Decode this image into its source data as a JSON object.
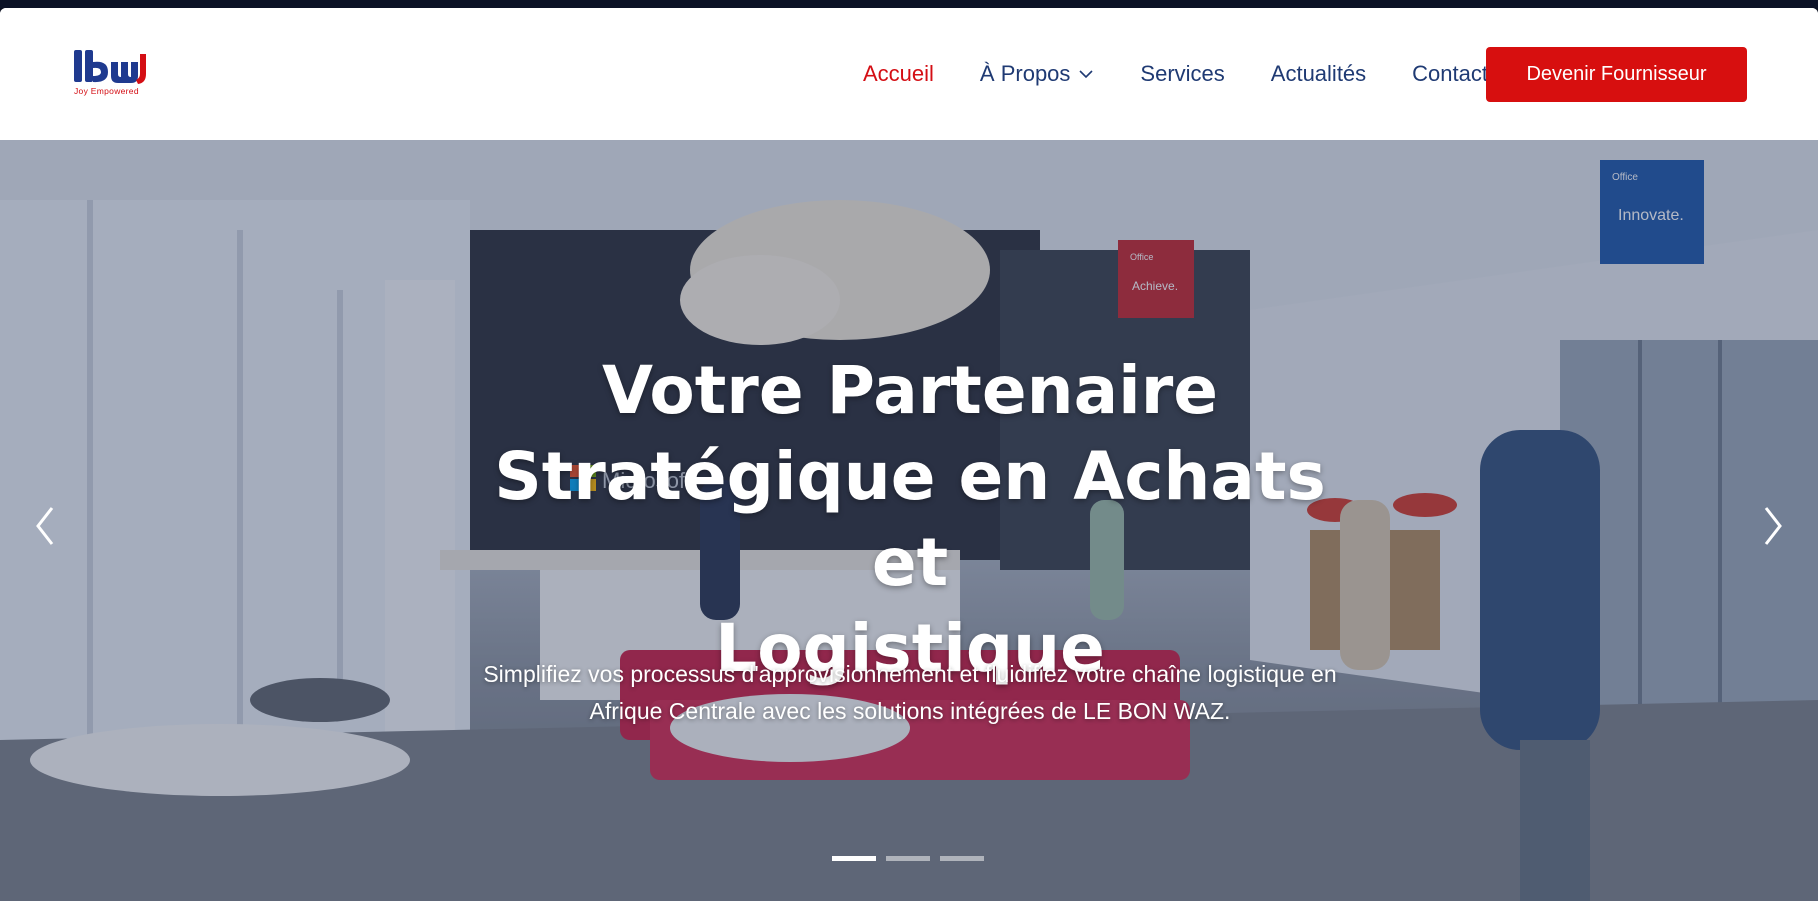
{
  "brand": {
    "logo_text": "lbw",
    "tagline": "Joy Empowered",
    "colors": {
      "blue": "#1f3a8f",
      "red": "#d40e14"
    }
  },
  "nav": {
    "items": [
      {
        "label": "Accueil",
        "active": true
      },
      {
        "label": "À Propos",
        "has_dropdown": true
      },
      {
        "label": "Services"
      },
      {
        "label": "Actualités"
      },
      {
        "label": "Contact"
      }
    ],
    "cta_label": "Devenir Fournisseur"
  },
  "hero": {
    "title_line1": "Votre Partenaire",
    "title_line2": "Stratégique en Achats et",
    "title_line3": "Logistique",
    "subtitle_line1": "Simplifiez vos processus d'approvisionnement et fluidifiez votre chaîne logistique en",
    "subtitle_line2": "Afrique Centrale avec les solutions intégrées de LE BON WAZ.",
    "background_signs": {
      "microsoft": "Microsoft",
      "office_red": "Office",
      "office_red_word": "Achieve.",
      "office_blue": "Office",
      "office_blue_word": "Innovate."
    },
    "slides": {
      "count": 3,
      "active_index": 0
    },
    "prev_icon": "chevron-left-icon",
    "next_icon": "chevron-right-icon"
  },
  "colors": {
    "accent_red": "#d70f0f",
    "nav_blue": "#1f3a73"
  }
}
